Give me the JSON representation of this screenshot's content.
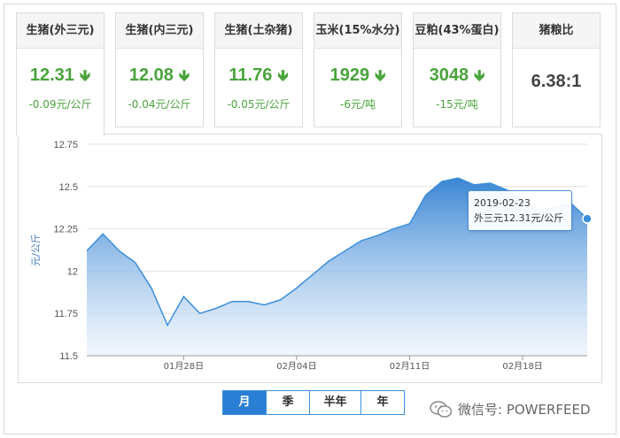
{
  "cards": [
    {
      "title": "生猪(外三元)",
      "price": "12.31",
      "change": "-0.09元/公斤",
      "trend": "down"
    },
    {
      "title": "生猪(内三元)",
      "price": "12.08",
      "change": "-0.04元/公斤",
      "trend": "down"
    },
    {
      "title": "生猪(土杂猪)",
      "price": "11.76",
      "change": "-0.05元/公斤",
      "trend": "down"
    },
    {
      "title": "玉米(15%水分)",
      "price": "1929",
      "change": "-6元/吨",
      "trend": "down"
    },
    {
      "title": "豆粕(43%蛋白)",
      "price": "3048",
      "change": "-15元/吨",
      "trend": "down"
    },
    {
      "title": "猪粮比",
      "price": "6.38:1",
      "change": "",
      "trend": "none"
    }
  ],
  "down_arrow": "🡻",
  "chart_data": {
    "type": "area",
    "title": "",
    "ylabel": "元/公斤",
    "xlabel": "",
    "ylim": [
      11.5,
      12.75
    ],
    "yticks": [
      "11.5",
      "11.75",
      "12",
      "12.25",
      "12.5",
      "12.75"
    ],
    "xticks": [
      {
        "label": "01月28日",
        "day": 6
      },
      {
        "label": "02月04日",
        "day": 13
      },
      {
        "label": "02月11日",
        "day": 20
      },
      {
        "label": "02月18日",
        "day": 27
      }
    ],
    "grid": "horizontal",
    "series": [
      {
        "name": "外三元",
        "color": "#3d8fd9",
        "x": [
          0,
          1,
          2,
          3,
          4,
          5,
          6,
          7,
          8,
          9,
          10,
          11,
          12,
          13,
          14,
          15,
          16,
          17,
          18,
          19,
          20,
          21,
          22,
          23,
          24,
          25,
          26,
          27,
          28,
          29,
          30,
          31
        ],
        "values": [
          12.12,
          12.22,
          12.12,
          12.05,
          11.9,
          11.68,
          11.85,
          11.75,
          11.78,
          11.82,
          11.82,
          11.8,
          11.83,
          11.9,
          11.98,
          12.06,
          12.12,
          12.18,
          12.21,
          12.25,
          12.28,
          12.45,
          12.53,
          12.55,
          12.51,
          12.52,
          12.48,
          12.42,
          12.36,
          12.38,
          12.4,
          12.31
        ]
      }
    ]
  },
  "tooltip": {
    "date": "2019-02-23",
    "value": "外三元12.31元/公斤"
  },
  "range_buttons": [
    "月",
    "季",
    "半年",
    "年"
  ],
  "selected_range": "月",
  "watermark": "微信号: POWERFEED"
}
